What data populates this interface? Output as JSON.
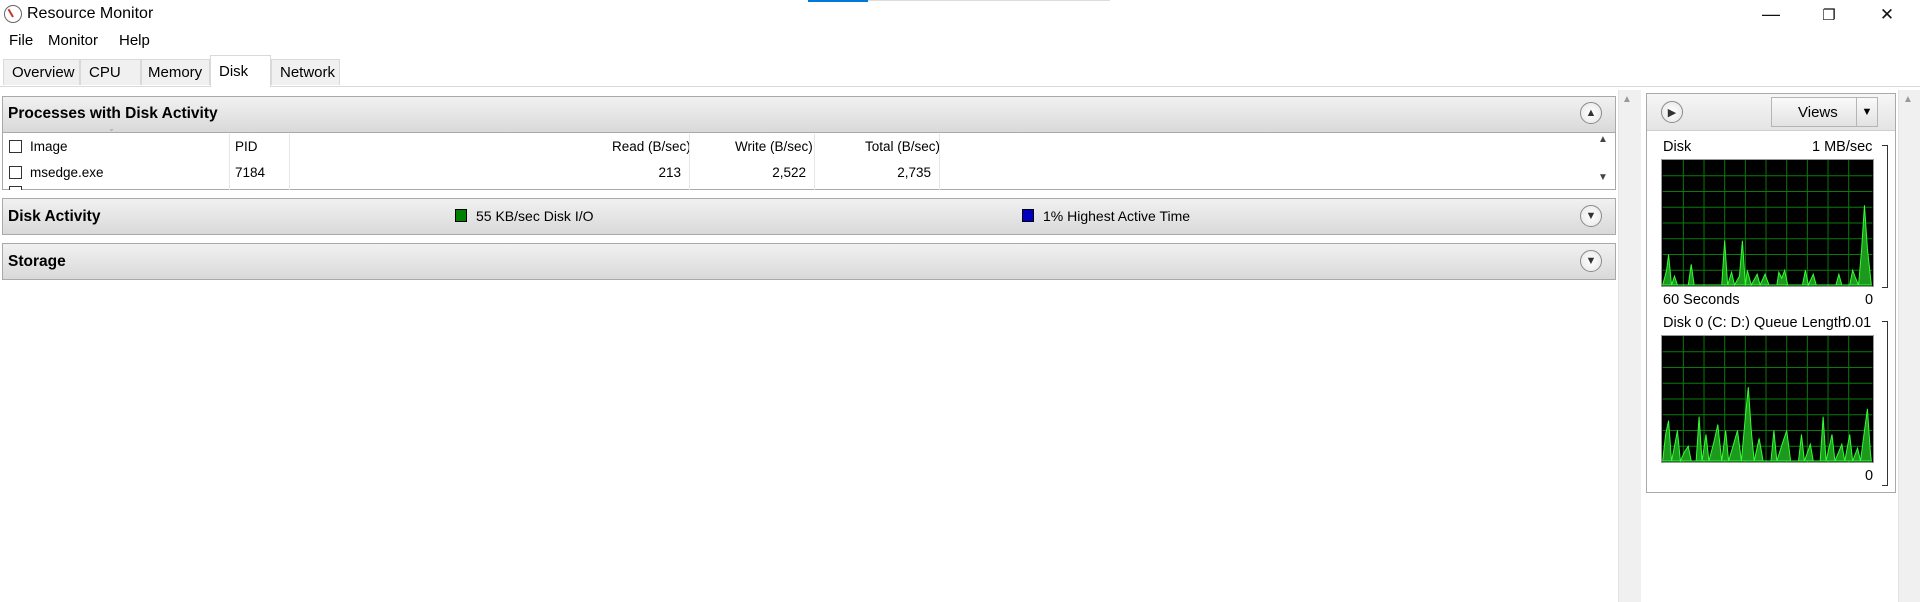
{
  "window": {
    "title": "Resource Monitor"
  },
  "titlebar_buttons": {
    "minimize": "—",
    "maximize": "❐",
    "close": "✕"
  },
  "menu": [
    "File",
    "Monitor",
    "Help"
  ],
  "tabs": [
    "Overview",
    "CPU",
    "Memory",
    "Disk",
    "Network"
  ],
  "active_tab": "Disk",
  "sections": {
    "processes": {
      "title": "Processes with Disk Activity",
      "columns": [
        "Image",
        "PID",
        "Read (B/sec)",
        "Write (B/sec)",
        "Total (B/sec)"
      ],
      "rows": [
        {
          "image": "msedge.exe",
          "pid": "7184",
          "read": "213",
          "write": "2,522",
          "total": "2,735"
        }
      ]
    },
    "disk_activity": {
      "title": "Disk Activity",
      "legend_io": "55 KB/sec Disk I/O",
      "legend_active": "1% Highest Active Time",
      "io_color": "#008000",
      "active_color": "#0000c0"
    },
    "storage": {
      "title": "Storage"
    }
  },
  "side_panel": {
    "views_label": "Views",
    "graph1": {
      "title": "Disk",
      "max": "1 MB/sec",
      "bottom_left": "60 Seconds",
      "bottom_right": "0"
    },
    "graph2": {
      "title": "Disk 0 (C: D:) Queue Length",
      "max": "0.01",
      "bottom_right": "0"
    }
  }
}
